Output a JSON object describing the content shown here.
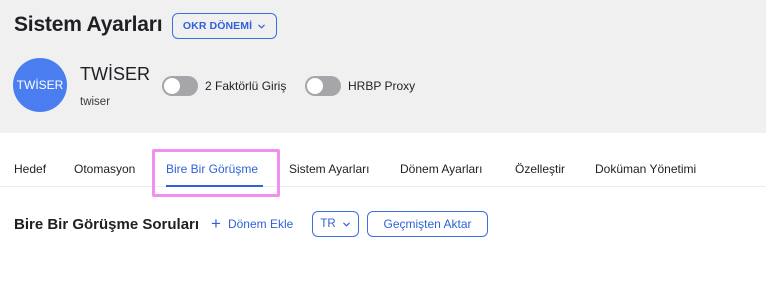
{
  "header": {
    "title": "Sistem Ayarları",
    "period_button_label": "OKR DÖNEMİ"
  },
  "organization": {
    "avatar_text": "TWİSER",
    "name": "TWİSER",
    "handle": "twiser"
  },
  "toggles": [
    {
      "label": "2 Faktörlü Giriş",
      "enabled": false
    },
    {
      "label": "HRBP Proxy",
      "enabled": false
    }
  ],
  "tabs": [
    {
      "label": "Hedef",
      "active": false
    },
    {
      "label": "Otomasyon",
      "active": false
    },
    {
      "label": "Bire Bir Görüşme",
      "active": true
    },
    {
      "label": "Sistem Ayarları",
      "active": false
    },
    {
      "label": "Dönem Ayarları",
      "active": false
    },
    {
      "label": "Özelleştir",
      "active": false
    },
    {
      "label": "Doküman Yönetimi",
      "active": false
    }
  ],
  "section": {
    "title": "Bire Bir Görüşme Soruları",
    "add_period_label": "Dönem Ekle",
    "language_value": "TR",
    "import_label": "Geçmişten Aktar"
  },
  "colors": {
    "accent": "#2f62d8",
    "avatar_bg": "#4a7ef0",
    "header_bg": "#f0f0f1",
    "highlight": "#f28ef2",
    "toggle_off": "#a5a5aa"
  }
}
